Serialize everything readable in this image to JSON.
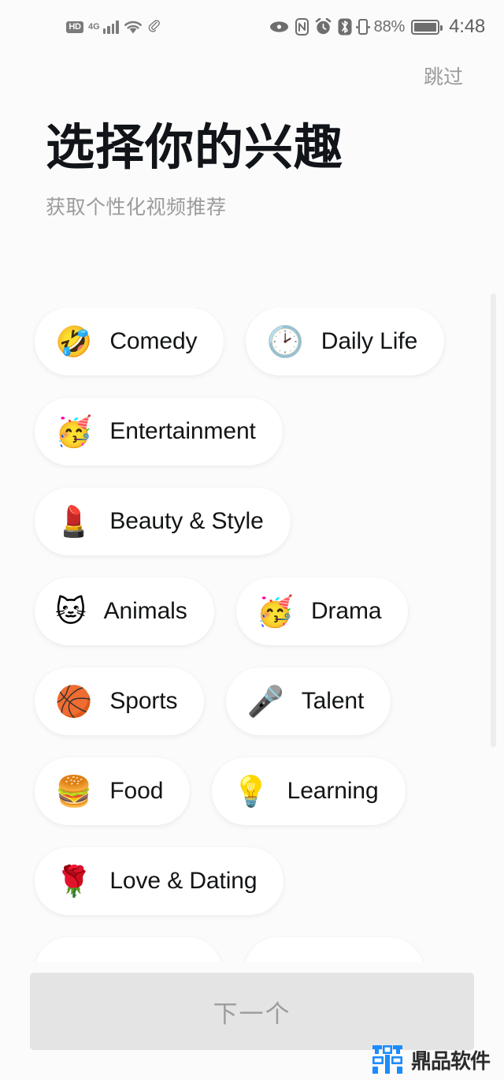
{
  "status_bar": {
    "hd_label": "HD",
    "network_label": "4G",
    "signal_icon": "signal-bars-icon",
    "wifi_icon": "wifi-icon",
    "link_icon": "paperclip-icon",
    "eye_icon": "eye-icon",
    "nfc_icon": "nfc-icon",
    "alarm_icon": "alarm-clock-icon",
    "bluetooth_icon": "bluetooth-icon",
    "power_saver_icon": "battery-saver-icon",
    "battery_percent": "88%",
    "battery_icon": "battery-icon",
    "time": "4:48"
  },
  "header": {
    "skip_label": "跳过",
    "title": "选择你的兴趣",
    "subtitle": "获取个性化视频推荐"
  },
  "interests": {
    "rows": [
      [
        {
          "emoji": "🤣",
          "icon": "rolling-on-the-floor-laughing-emoji",
          "label": "Comedy",
          "selected": false
        },
        {
          "emoji": "🕑",
          "icon": "clock-emoji",
          "label": "Daily Life",
          "selected": false
        }
      ],
      [
        {
          "emoji": "🥳",
          "icon": "partying-face-emoji",
          "label": "Entertainment",
          "selected": false
        }
      ],
      [
        {
          "emoji": "💄",
          "icon": "lipstick-emoji",
          "label": "Beauty & Style",
          "selected": false
        }
      ],
      [
        {
          "emoji": "🐱",
          "icon": "cat-face-emoji",
          "label": "Animals",
          "selected": false
        },
        {
          "emoji": "🥳",
          "icon": "partying-face-emoji",
          "label": "Drama",
          "selected": false
        }
      ],
      [
        {
          "emoji": "🏀",
          "icon": "basketball-emoji",
          "label": "Sports",
          "selected": false
        },
        {
          "emoji": "🎤",
          "icon": "microphone-emoji",
          "label": "Talent",
          "selected": false
        }
      ],
      [
        {
          "emoji": "🍔",
          "icon": "hamburger-emoji",
          "label": "Food",
          "selected": false
        },
        {
          "emoji": "💡",
          "icon": "light-bulb-emoji",
          "label": "Learning",
          "selected": false
        }
      ],
      [
        {
          "emoji": "🌹",
          "icon": "rose-emoji",
          "label": "Love & Dating",
          "selected": false
        }
      ],
      [
        {
          "emoji": "",
          "icon": "chip-partial-icon",
          "label": "",
          "selected": false
        },
        {
          "emoji": "",
          "icon": "chip-partial-icon",
          "label": "",
          "selected": false
        }
      ]
    ]
  },
  "bottom": {
    "next_label": "下一个",
    "watermark_text": "鼎品软件",
    "watermark_icon": "dingpin-logo-icon"
  },
  "colors": {
    "background": "#fbfbfb",
    "chip_background": "#ffffff",
    "title": "#111418",
    "subtitle": "#9b9b9b",
    "next_button_bg": "#e4e4e4",
    "next_button_text": "#9d9d9d",
    "watermark_blue": "#1a8cff"
  }
}
